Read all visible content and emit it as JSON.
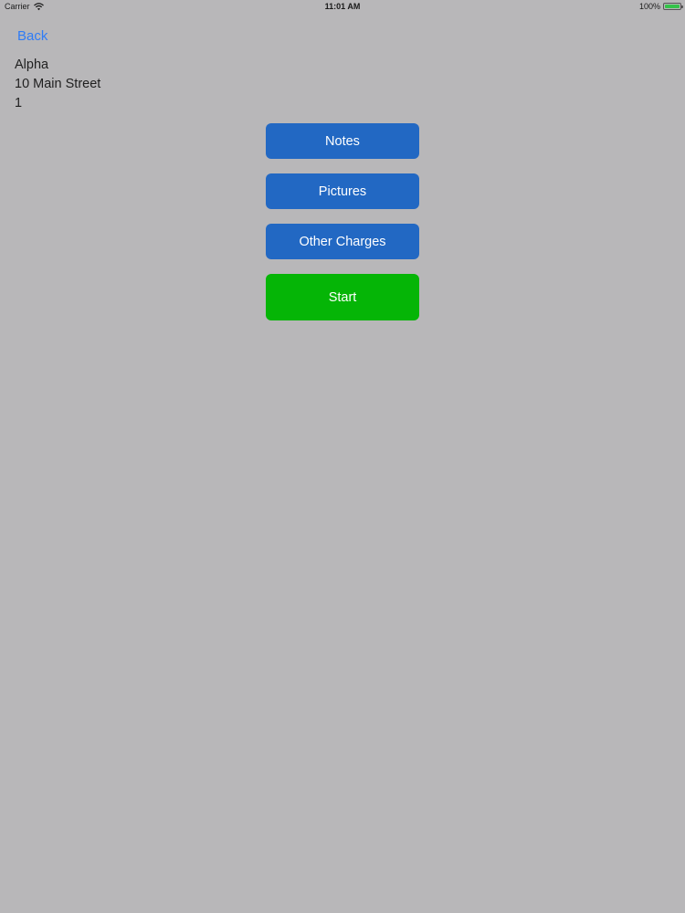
{
  "status_bar": {
    "carrier": "Carrier",
    "time": "11:01 AM",
    "battery_percent": "100%",
    "battery_level": 1.0,
    "battery_color": "#35c24a"
  },
  "nav": {
    "back_label": "Back",
    "link_color": "#2f7cf6"
  },
  "job": {
    "name": "Alpha",
    "address": "10 Main Street",
    "number": "1"
  },
  "actions": {
    "notes_label": "Notes",
    "pictures_label": "Pictures",
    "other_charges_label": "Other Charges",
    "start_label": "Start",
    "primary_color": "#2268c3",
    "start_color": "#05b506"
  },
  "background_color": "#b8b7b9"
}
